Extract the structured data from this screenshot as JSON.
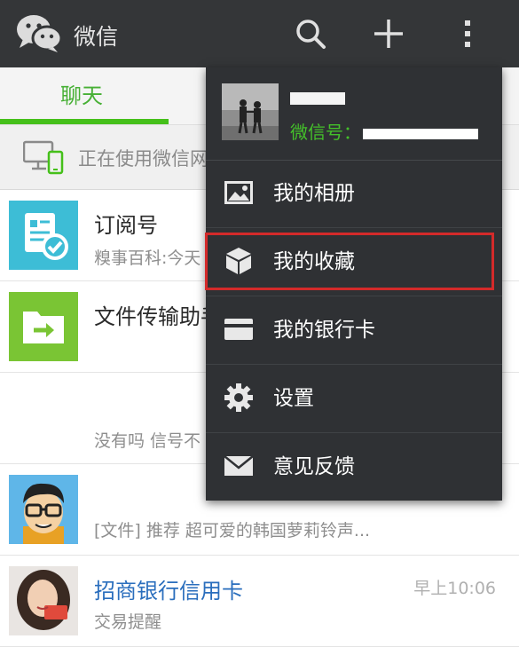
{
  "app": {
    "title": "微信"
  },
  "tabs": [
    {
      "label": "聊天"
    }
  ],
  "notice": {
    "text": "正在使用微信网页版"
  },
  "chats": [
    {
      "name": "订阅号",
      "preview": "糗事百科:今天",
      "time": ""
    },
    {
      "name": "文件传输助手",
      "preview": "",
      "time": ""
    },
    {
      "name": "",
      "preview": "没有吗 信号不",
      "time": ""
    },
    {
      "name": "",
      "preview": "[文件] 推荐 超可爱的韩国萝莉铃声...",
      "time": ""
    },
    {
      "name": "招商银行信用卡",
      "preview": "交易提醒",
      "time": "早上10:06"
    }
  ],
  "menu": {
    "profile": {
      "wxid_label": "微信号："
    },
    "items": [
      {
        "label": "我的相册",
        "icon": "photo-album-icon"
      },
      {
        "label": "我的收藏",
        "icon": "favorites-cube-icon",
        "highlighted": true
      },
      {
        "label": "我的银行卡",
        "icon": "bank-card-icon"
      },
      {
        "label": "设置",
        "icon": "gear-icon"
      },
      {
        "label": "意见反馈",
        "icon": "envelope-icon"
      }
    ]
  },
  "colors": {
    "accent": "#45c01a",
    "topbar": "#343638",
    "menu_bg": "#2f3134",
    "highlight": "#d42a2a",
    "bank_name": "#2a6ebd"
  }
}
